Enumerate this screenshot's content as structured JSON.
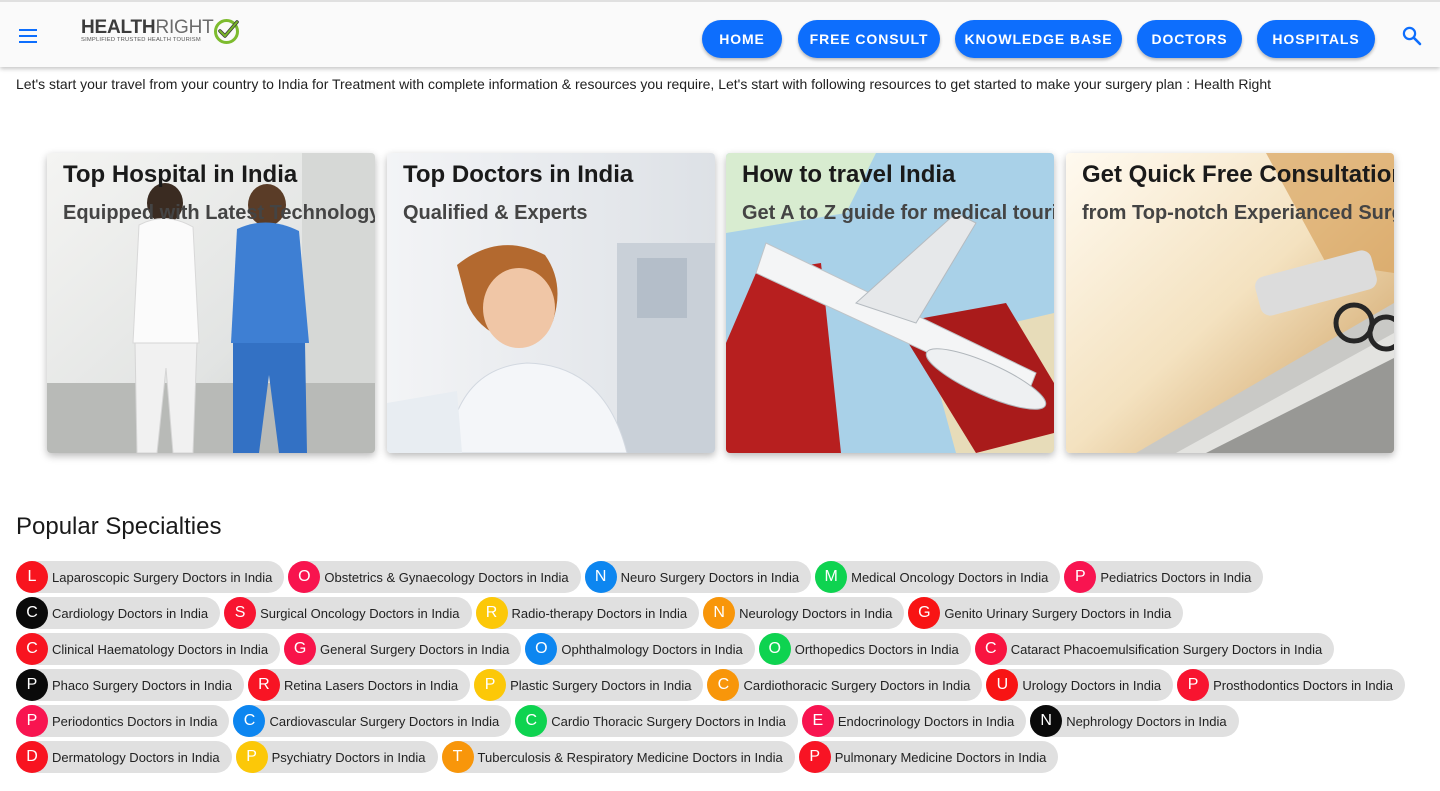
{
  "header": {
    "logo_word_bold": "HEALTH",
    "logo_word_light": "RIGHT",
    "logo_tagline": "Simplified Trusted Health Tourism",
    "menu_icon": "hamburger-menu-icon",
    "search_icon": "search-icon",
    "nav": {
      "home": "HOME",
      "free_consult": "FREE CONSULT",
      "knowledge_base": "KNOWLEDGE BASE",
      "doctors": "DOCTORS",
      "hospitals": "HOSPITALS"
    },
    "nav_color": "#0d6efd"
  },
  "intro": "Let's start your travel from your country to India for Treatment with complete information & resources you require, Let's start with following resources to get started to make your surgery plan : Health Right",
  "cards": [
    {
      "title": "Top Hospital in India",
      "subtitle": "Equipped with Latest Technology"
    },
    {
      "title": "Top Doctors in India",
      "subtitle": "Qualified & Experts"
    },
    {
      "title": "How to travel India",
      "subtitle": "Get A to Z guide for medical tourism"
    },
    {
      "title": "Get Quick Free Consultation",
      "subtitle": "from Top-notch Experianced Surgeons"
    }
  ],
  "specialties": {
    "title": "Popular Specialties",
    "rows": [
      [
        {
          "letter": "L",
          "label": "Laparoscopic Surgery Doctors in India",
          "color": "#f8141e"
        },
        {
          "letter": "O",
          "label": "Obstetrics & Gynaecology Doctors in India",
          "color": "#f8144e"
        },
        {
          "letter": "N",
          "label": "Neuro Surgery Doctors in India",
          "color": "#0d86f0"
        },
        {
          "letter": "M",
          "label": "Medical Oncology Doctors in India",
          "color": "#0ed350"
        },
        {
          "letter": "P",
          "label": "Pediatrics Doctors in India",
          "color": "#f81450"
        }
      ],
      [
        {
          "letter": "C",
          "label": "Cardiology Doctors in India",
          "color": "#0a0a0a"
        },
        {
          "letter": "S",
          "label": "Surgical Oncology Doctors in India",
          "color": "#f81430"
        },
        {
          "letter": "R",
          "label": "Radio-therapy Doctors in India",
          "color": "#fcc808"
        },
        {
          "letter": "N",
          "label": "Neurology Doctors in India",
          "color": "#f8960a"
        },
        {
          "letter": "G",
          "label": "Genito Urinary Surgery Doctors in India",
          "color": "#f81414"
        }
      ],
      [
        {
          "letter": "C",
          "label": "Clinical Haematology Doctors in India",
          "color": "#f81420"
        },
        {
          "letter": "G",
          "label": "General Surgery Doctors in India",
          "color": "#f8144a"
        },
        {
          "letter": "O",
          "label": "Ophthalmology Doctors in India",
          "color": "#0d86f0"
        },
        {
          "letter": "O",
          "label": "Orthopedics Doctors in India",
          "color": "#0ed350"
        },
        {
          "letter": "C",
          "label": "Cataract Phacoemulsification Surgery Doctors in India",
          "color": "#f81440"
        }
      ],
      [
        {
          "letter": "P",
          "label": "Phaco Surgery Doctors in India",
          "color": "#0a0a0a"
        },
        {
          "letter": "R",
          "label": "Retina Lasers Doctors in India",
          "color": "#f81424"
        },
        {
          "letter": "P",
          "label": "Plastic Surgery Doctors in India",
          "color": "#fcc808"
        },
        {
          "letter": "C",
          "label": "Cardiothoracic Surgery Doctors in India",
          "color": "#f8960a"
        },
        {
          "letter": "U",
          "label": "Urology Doctors in India",
          "color": "#f81414"
        },
        {
          "letter": "P",
          "label": "Prosthodontics Doctors in India",
          "color": "#f81430"
        }
      ],
      [
        {
          "letter": "P",
          "label": "Periodontics Doctors in India",
          "color": "#f81450"
        },
        {
          "letter": "C",
          "label": "Cardiovascular Surgery Doctors in India",
          "color": "#0d86f0"
        },
        {
          "letter": "C",
          "label": "Cardio Thoracic Surgery Doctors in India",
          "color": "#0ed350"
        },
        {
          "letter": "E",
          "label": "Endocrinology Doctors in India",
          "color": "#f81450"
        },
        {
          "letter": "N",
          "label": "Nephrology Doctors in India",
          "color": "#0a0a0a"
        }
      ],
      [
        {
          "letter": "D",
          "label": "Dermatology Doctors in India",
          "color": "#f81420"
        },
        {
          "letter": "P",
          "label": "Psychiatry Doctors in India",
          "color": "#fcc808"
        },
        {
          "letter": "T",
          "label": "Tuberculosis & Respiratory Medicine Doctors in India",
          "color": "#f8960a"
        },
        {
          "letter": "P",
          "label": "Pulmonary Medicine Doctors in India",
          "color": "#f81424"
        }
      ]
    ]
  }
}
